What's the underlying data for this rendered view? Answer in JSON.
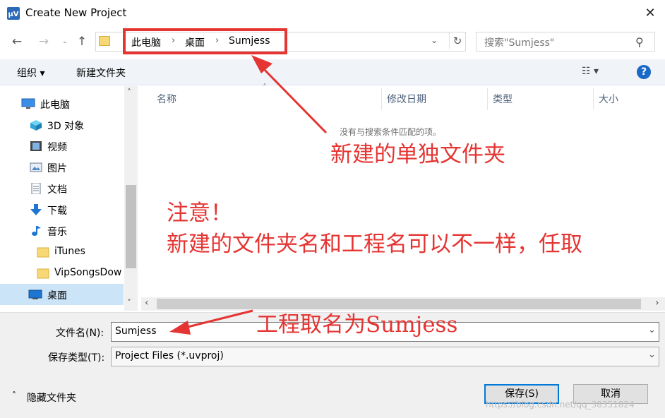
{
  "window": {
    "title": "Create New Project",
    "close_glyph": "✕"
  },
  "address": {
    "crumbs": [
      "此电脑",
      "桌面",
      "Sumjess"
    ],
    "search_placeholder": "搜索\"Sumjess\""
  },
  "toolbar": {
    "organize": "组织 ▾",
    "new_folder": "新建文件夹",
    "view": "☷ ▾",
    "help": "?"
  },
  "sidebar": {
    "items": [
      {
        "label": "此电脑",
        "icon": "monitor-icon"
      },
      {
        "label": "3D 对象",
        "icon": "cube-icon"
      },
      {
        "label": "视频",
        "icon": "film-icon"
      },
      {
        "label": "图片",
        "icon": "picture-icon"
      },
      {
        "label": "文档",
        "icon": "document-icon"
      },
      {
        "label": "下载",
        "icon": "download-arrow-icon"
      },
      {
        "label": "音乐",
        "icon": "music-note-icon"
      },
      {
        "label": "iTunes",
        "icon": "folder-icon"
      },
      {
        "label": "VipSongsDow",
        "icon": "folder-icon"
      },
      {
        "label": "桌面",
        "icon": "desktop-icon"
      }
    ]
  },
  "columns": [
    "名称",
    "修改日期",
    "类型",
    "大小"
  ],
  "empty_message": "没有与搜索条件匹配的项。",
  "form": {
    "filename_label": "文件名(N):",
    "filename_value": "Sumjess",
    "filetype_label": "保存类型(T):",
    "filetype_value": "Project Files (*.uvproj)"
  },
  "footer": {
    "hide_folders": "隐藏文件夹",
    "save": "保存(S)",
    "cancel": "取消"
  },
  "annotations": {
    "note1": "新建的单独文件夹",
    "note2": "注意！",
    "note3": "新建的文件夹名和工程名可以不一样，任取",
    "note4": "工程取名为Sumjess"
  },
  "watermark": "https://blog.csdn.net/qq_38351824",
  "colors": {
    "annotation_red": "#e53533",
    "selection_blue": "#cce4f7",
    "primary_button_border": "#0078d7"
  }
}
